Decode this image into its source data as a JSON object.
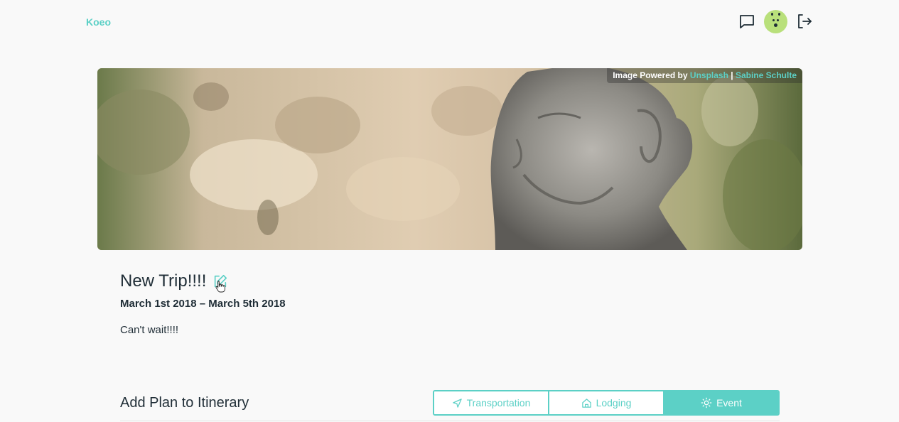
{
  "brand": {
    "name": "Koeo",
    "accent": "#5cd0c6"
  },
  "nav": {
    "icons": [
      "chat-icon",
      "avatar",
      "logout-icon"
    ]
  },
  "hero": {
    "credit_prefix": "Image Powered by",
    "credit_source": "Unsplash",
    "credit_separator": "|",
    "credit_author": "Sabine Schulte"
  },
  "trip": {
    "title": "New Trip!!!!",
    "dates": "March 1st 2018 – March 5th 2018",
    "description": "Can't wait!!!!"
  },
  "plan": {
    "title": "Add Plan to Itinerary",
    "tabs": [
      {
        "label": "Transportation",
        "icon": "navigation-arrow-icon",
        "active": false
      },
      {
        "label": "Lodging",
        "icon": "home-icon",
        "active": false
      },
      {
        "label": "Event",
        "icon": "sun-icon",
        "active": true
      }
    ]
  }
}
